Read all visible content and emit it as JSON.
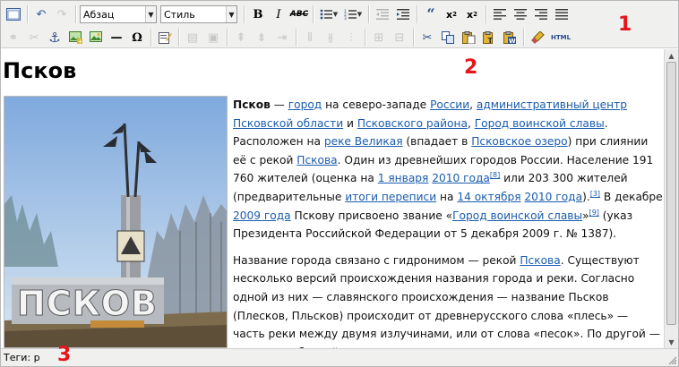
{
  "toolbar": {
    "format_select": "Абзац",
    "style_select": "Стиль",
    "html_label": "HTML"
  },
  "annotations": {
    "toolbar_marker": "1",
    "editor_marker": "2",
    "status_marker": "3"
  },
  "content": {
    "title": "Псков",
    "paragraph1": {
      "city_name": "Псков",
      "t1": " — ",
      "link_city": "город",
      "t2": " на северо-западе ",
      "link_russia": "России",
      "t3": ", ",
      "link_admin_center": "административный центр Псковской области",
      "t4": " и ",
      "link_district": "Псковского района",
      "t5": ", ",
      "link_military_glory": "Город воинской славы",
      "t6": ". Расположен на ",
      "link_velikaya": "реке Великая",
      "t7": " (впадает в ",
      "link_lake": "Псковское озеро",
      "t8": ") при слиянии её с рекой ",
      "link_pskova": "Пскова",
      "t9": ". Один из древнейших городов России. Население 191 760 жителей (оценка на ",
      "link_jan1": "1 января",
      "t10": " ",
      "link_2010": "2010 года",
      "ref8": "[8]",
      "t11": " или 203 300 жителей (предварительные ",
      "link_census": "итоги переписи",
      "t12": " на ",
      "link_oct14": "14 октября",
      "t13": " ",
      "link_2010b": "2010 года",
      "t14": ").",
      "ref3": "[3]",
      "t15": " В декабре ",
      "link_2009": "2009 года",
      "t16": " Пскову присвоено звание «",
      "link_title": "Город воинской славы",
      "t17": "»",
      "ref9": "[9]",
      "t18": " (указ Президента Российской Федерации от 5 декабря 2009 г. № 1387)."
    },
    "paragraph2": {
      "t1": "Название города связано с гидронимом — рекой ",
      "link_pskova": "Пскова",
      "t2": ". Существуют несколько версий происхождения названия города и реки. Согласно одной из них — славянского происхождения — название Пьсков (Плесков, Пльсков) происходит от древнерусского слова «плесь» — часть реки между двумя излучинами, или от слова «песок». По другой — версии прибалтийско-финского происхождения — название происходит"
    },
    "photo_sign_text": "ПСКОВ"
  },
  "status": {
    "path_label": "Теги: p"
  },
  "colors": {
    "link": "#1a5cad",
    "marker": "#e8141a",
    "toolbar_bg": "#f0f0ee"
  }
}
